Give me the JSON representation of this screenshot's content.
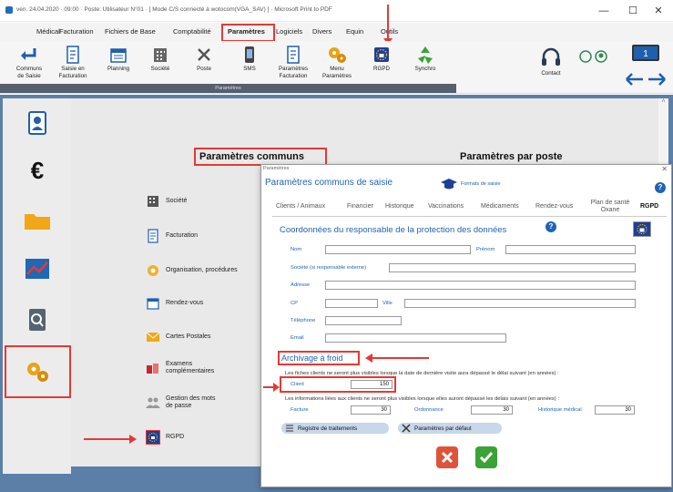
{
  "window": {
    "title": "ven. 24.04.2020 · 09:00 · Poste: Utilisateur N°01 · [ Mode C/S connecté à wotocom(VGA_SAV) ] · Microsoft Print to PDF",
    "minimize": "—",
    "maximize": "☐",
    "close": "✕"
  },
  "menu": {
    "items": [
      "Médical",
      "Facturation",
      "Fichiers de Base",
      "Comptabilité",
      "Paramètres",
      "Logiciels",
      "Divers",
      "Equin",
      "Outils"
    ],
    "active": "Paramètres"
  },
  "ribbon": {
    "buttons": [
      {
        "label1": "Communs",
        "label2": "de Saisie",
        "icon": "arrow-left-icon"
      },
      {
        "label1": "Saisie en",
        "label2": "Facturation",
        "icon": "invoice-icon"
      },
      {
        "label1": "Planning",
        "label2": "",
        "icon": "calendar-icon"
      },
      {
        "label1": "Société",
        "label2": "",
        "icon": "building-icon"
      },
      {
        "label1": "Poste",
        "label2": "",
        "icon": "tools-icon"
      },
      {
        "label1": "SMS",
        "label2": "",
        "icon": "phone-icon"
      },
      {
        "label1": "Paramètres",
        "label2": "Facturation",
        "icon": "invoice-settings-icon"
      },
      {
        "label1": "Menu",
        "label2": "Paramètres",
        "icon": "gears-icon"
      },
      {
        "label1": "RGPD",
        "label2": "",
        "icon": "eu-lock-icon"
      },
      {
        "label1": "Synchro",
        "label2": "",
        "icon": "recycle-icon"
      }
    ],
    "group_label": "Paramètres",
    "contact_label": "Contact",
    "monitor_number": "1"
  },
  "main": {
    "heading_left": "Paramètres communs",
    "heading_right": "Paramètres par poste",
    "list": [
      {
        "label": "Société",
        "icon": "building-icon"
      },
      {
        "label": "Facturation",
        "icon": "invoice-icon"
      },
      {
        "label": "Organisation, procédures",
        "icon": "gear-icon"
      },
      {
        "label": "Rendez-vous",
        "icon": "calendar-icon"
      },
      {
        "label": "Cartes Postales",
        "icon": "envelope-icon"
      },
      {
        "label": "Examens complémentaires",
        "icon": "flask-icon"
      },
      {
        "label": "Gestion des mots de passe",
        "icon": "users-icon"
      },
      {
        "label": "RGPD",
        "icon": "eu-lock-icon"
      }
    ]
  },
  "dialog": {
    "window_title": "Paramètres",
    "heading": "Paramètres communs de saisie",
    "formats_link": "Formats de saisie",
    "tabs": [
      "Clients / Animaux",
      "Financier",
      "Historique",
      "Vaccinations",
      "Médicaments",
      "Rendez-vous",
      "Plan de santé",
      "Oxane",
      "RGPD"
    ],
    "active_tab": "RGPD",
    "dpo_title": "Coordonnées du responsable de la protection des données",
    "fields": {
      "nom": "Nom",
      "prenom": "Prénom",
      "societe": "Société (si responsable externe)",
      "adresse": "Adresse",
      "cp": "CP",
      "ville": "Ville",
      "telephone": "Téléphone",
      "email": "Email"
    },
    "archive_title": "Archivage à froid",
    "archive_text1": "Les fiches clients ne seront plus visibles lorsque la date de dernière visite aura dépassé le délai suivant (en années) :",
    "client_label": "Client",
    "client_value": "150",
    "archive_text2": "Les informations liées aux clients ne seront plus visibles lorsque elles auront dépassé les délais suivant (en années) :",
    "facture_label": "Facture",
    "facture_value": "30",
    "ordonnance_label": "Ordonnance",
    "ordonnance_value": "30",
    "historique_label": "Historique médical",
    "historique_value": "30",
    "registre_button": "Registre de traitements",
    "defaults_button": "Paramètres par défaut",
    "help": "?"
  },
  "colors": {
    "accent": "#1f63b5",
    "annotation": "#e53935",
    "background": "#5c7fa8"
  }
}
